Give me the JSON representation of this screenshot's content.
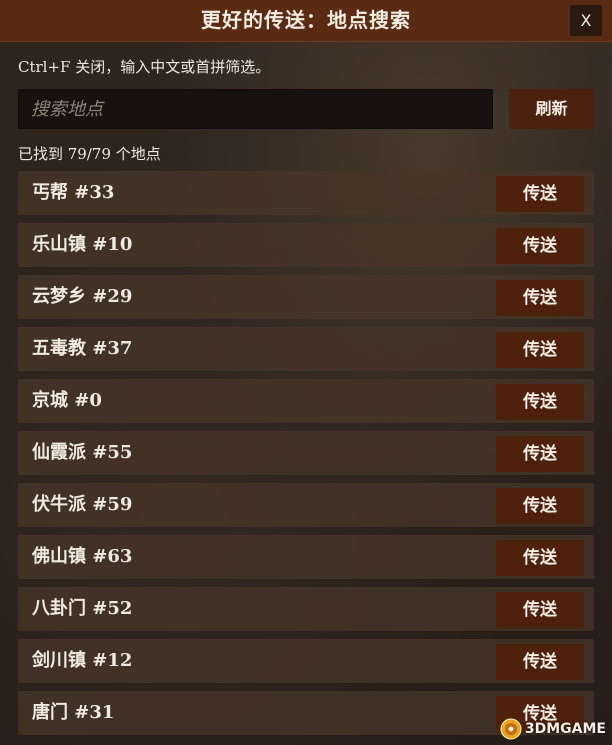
{
  "window": {
    "title": "更好的传送：地点搜索",
    "close_label": "X"
  },
  "hint": "Ctrl+F 关闭，输入中文或首拼筛选。",
  "search": {
    "placeholder": "搜索地点",
    "value": ""
  },
  "refresh_label": "刷新",
  "result_count": "已找到 79/79 个地点",
  "locations": [
    {
      "name": "丐帮  #33",
      "button": "传送"
    },
    {
      "name": "乐山镇  #10",
      "button": "传送"
    },
    {
      "name": "云梦乡  #29",
      "button": "传送"
    },
    {
      "name": "五毒教  #37",
      "button": "传送"
    },
    {
      "name": "京城  #0",
      "button": "传送"
    },
    {
      "name": "仙霞派  #55",
      "button": "传送"
    },
    {
      "name": "伏牛派  #59",
      "button": "传送"
    },
    {
      "name": "佛山镇  #63",
      "button": "传送"
    },
    {
      "name": "八卦门  #52",
      "button": "传送"
    },
    {
      "name": "剑川镇  #12",
      "button": "传送"
    },
    {
      "name": "唐门  #31",
      "button": "传送"
    }
  ],
  "watermark": {
    "text": "3DMGAME"
  },
  "colors": {
    "title_bar": "#5a2b13",
    "button": "#4e210d",
    "row_background": "#483428",
    "search_background": "#17120f"
  }
}
